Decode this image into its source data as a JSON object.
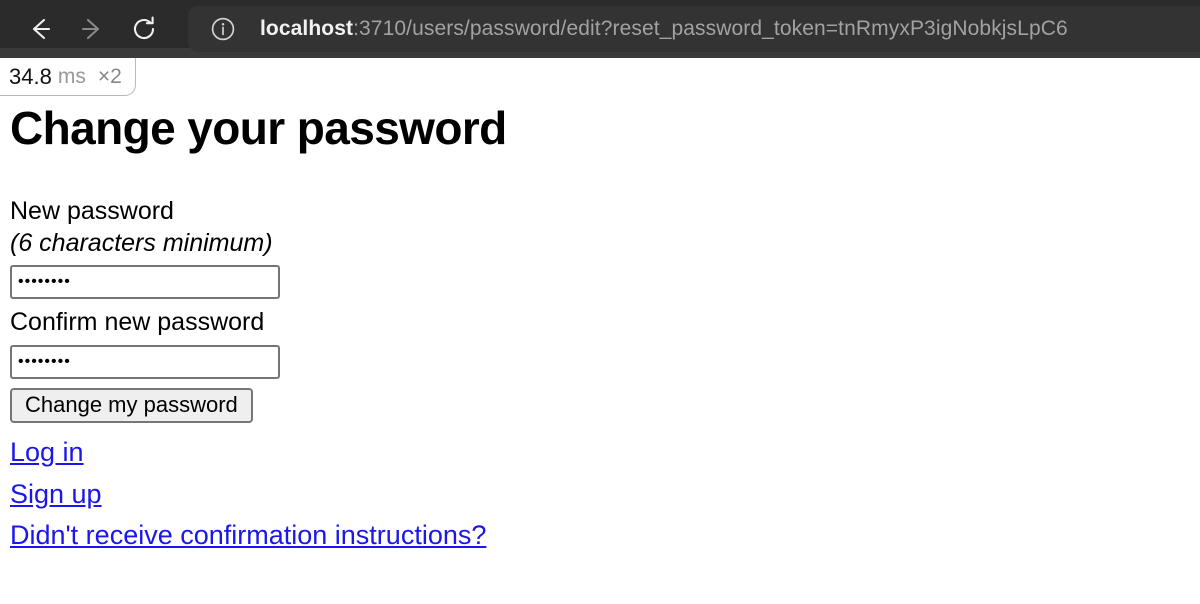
{
  "browser": {
    "back_icon": "arrow-left-icon",
    "forward_icon": "arrow-right-icon",
    "reload_icon": "reload-icon",
    "site_info_icon": "info-circle-icon",
    "url_host": "localhost",
    "url_rest": ":3710/users/password/edit?reset_password_token=tnRmyxP3igNobkjsLpC6",
    "url_full": "localhost:3710/users/password/edit?reset_password_token=tnRmyxP3igNobkjsLpC6",
    "toolbar_bg": "#2b2b2b",
    "urlbar_bg": "#333333"
  },
  "profiler": {
    "time": "34.8",
    "unit": "ms",
    "count": "×2"
  },
  "page": {
    "title": "Change your password"
  },
  "form": {
    "new_password": {
      "label": "New password",
      "hint": "(6 characters minimum)",
      "value": "password",
      "placeholder": ""
    },
    "confirm_password": {
      "label": "Confirm new password",
      "value": "password",
      "placeholder": ""
    },
    "submit_label": "Change my password"
  },
  "links": [
    {
      "label": "Log in"
    },
    {
      "label": "Sign up"
    },
    {
      "label": "Didn't receive confirmation instructions?"
    }
  ],
  "colors": {
    "link": "#1a16ec",
    "button_bg": "#efefef",
    "input_border": "#767676"
  }
}
